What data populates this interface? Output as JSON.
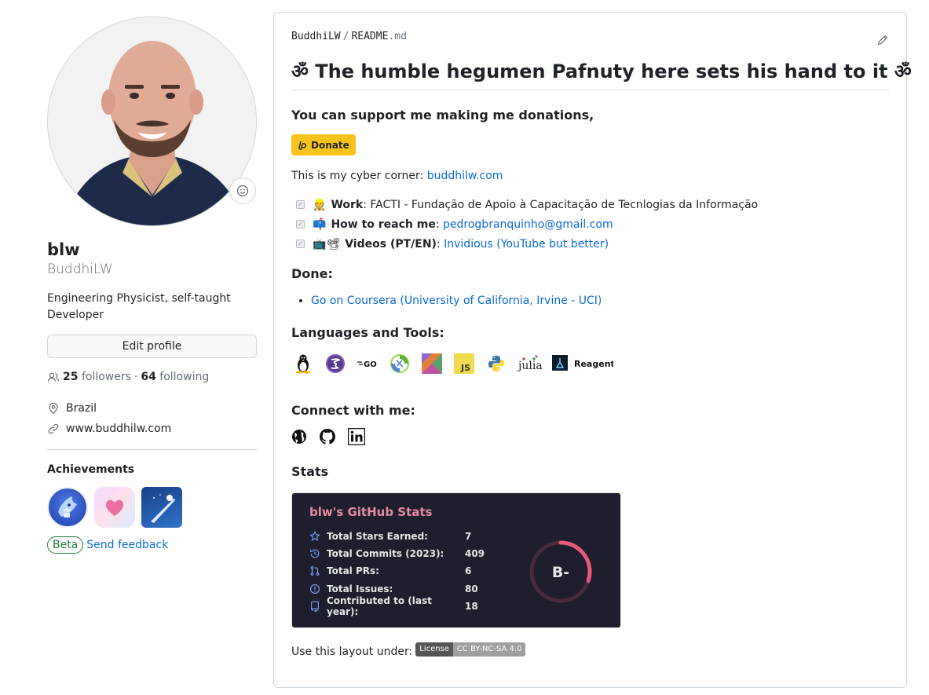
{
  "profile": {
    "fullname": "blw",
    "username": "BuddhiLW",
    "bio": "Engineering Physicist, self-taught Developer",
    "edit_label": "Edit profile",
    "followers_count": "25",
    "followers_label": "followers",
    "following_count": "64",
    "following_label": "following",
    "dot": "·",
    "location": "Brazil",
    "website": "www.buddhilw.com",
    "achievements_title": "Achievements",
    "beta_label": "Beta",
    "feedback_label": "Send feedback"
  },
  "readme": {
    "owner": "BuddhiLW",
    "slash": "/",
    "file_base": "README",
    "file_ext": ".md",
    "title": "ॐ The humble hegumen Pafnuty here sets his hand to it ॐ",
    "support_text": "You can support me making me donations,",
    "donate_label": "Donate",
    "cyber_prefix": "This is my cyber corner: ",
    "cyber_link": "buddhilw.com",
    "tasks": [
      {
        "emoji": "👷",
        "label": "Work",
        "sep": ": ",
        "text": "FACTI - Fundação de Apoio à Capacitação de Tecnlogias da Informação",
        "link": ""
      },
      {
        "emoji": "📫",
        "label": "How to reach me",
        "sep": ": ",
        "text": "",
        "link": "pedrogbranquinho@gmail.com"
      },
      {
        "emoji": "📺📽",
        "label": "Videos (PT/EN)",
        "sep": ": ",
        "text": "",
        "link": "Invidious (YouTube but better)"
      }
    ],
    "done_title": "Done:",
    "done_items": [
      "Go on Coursera (University of California, Irvine - UCI)"
    ],
    "languages_title": "Languages and Tools:",
    "tools": [
      "linux-icon",
      "emacs-icon",
      "go-icon",
      "clojure-icon",
      "kotlin-icon",
      "javascript-icon",
      "python-icon",
      "julia-icon",
      "reagent-icon"
    ],
    "tool_text": {
      "julia": "julia",
      "reagent": "Reagent",
      "js": "JS",
      "go": "GO"
    },
    "connect_title": "Connect with me:",
    "stats_title": "Stats",
    "license_prefix": "Use this layout under: ",
    "license_left": "License",
    "license_right": "CC BY-NC-SA 4.0"
  },
  "stats_card": {
    "title": "blw's GitHub Stats",
    "rows": [
      {
        "label": "Total Stars Earned:",
        "value": "7",
        "icon": "star-icon"
      },
      {
        "label": "Total Commits (2023):",
        "value": "409",
        "icon": "history-icon"
      },
      {
        "label": "Total PRs:",
        "value": "6",
        "icon": "pull-request-icon"
      },
      {
        "label": "Total Issues:",
        "value": "80",
        "icon": "issue-icon"
      },
      {
        "label": "Contributed to (last year):",
        "value": "18",
        "icon": "repo-icon"
      }
    ],
    "rank": "B-",
    "rank_progress": 0.3,
    "colors": {
      "title": "#e88aa5",
      "background": "#1e1e2e",
      "ring": "#e8587d",
      "icon": "#7aa2f7"
    }
  },
  "colors": {
    "link": "#0969da",
    "donate": "#f7c31c",
    "beta": "#1a7f37"
  }
}
